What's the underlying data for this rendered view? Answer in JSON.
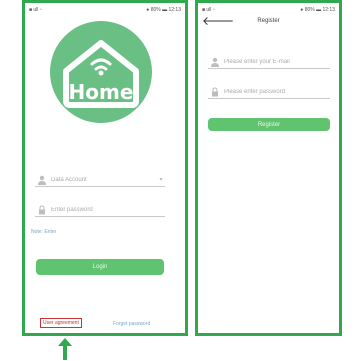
{
  "left_screen": {
    "status_left": "■ ull ▫",
    "status_right": "● 80% ▬ 12:13",
    "logo_text": "Home",
    "account_field": {
      "placeholder": "Data Account"
    },
    "password_field": {
      "placeholder": "Enter password"
    },
    "register_link": "Note: Enter",
    "login_button": "Login",
    "user_agreement": "User agreement",
    "forgot_password": "Forget password"
  },
  "right_screen": {
    "status_left": "■ ull ▫",
    "status_right": "● 80% ▬ 12:13",
    "title": "Register",
    "phone_field": {
      "placeholder": "Please enter your E-mail"
    },
    "password_field": {
      "placeholder": "Please enter password"
    },
    "register_button": "Register"
  },
  "colors": {
    "frame": "#2fa84f",
    "logo": "#6abf84",
    "button": "#5fc36f",
    "highlight": "#c33333"
  },
  "icons": [
    "user-icon",
    "lock-icon",
    "chevron-down-icon",
    "back-arrow-icon",
    "wifi-icon",
    "up-arrow-icon"
  ]
}
